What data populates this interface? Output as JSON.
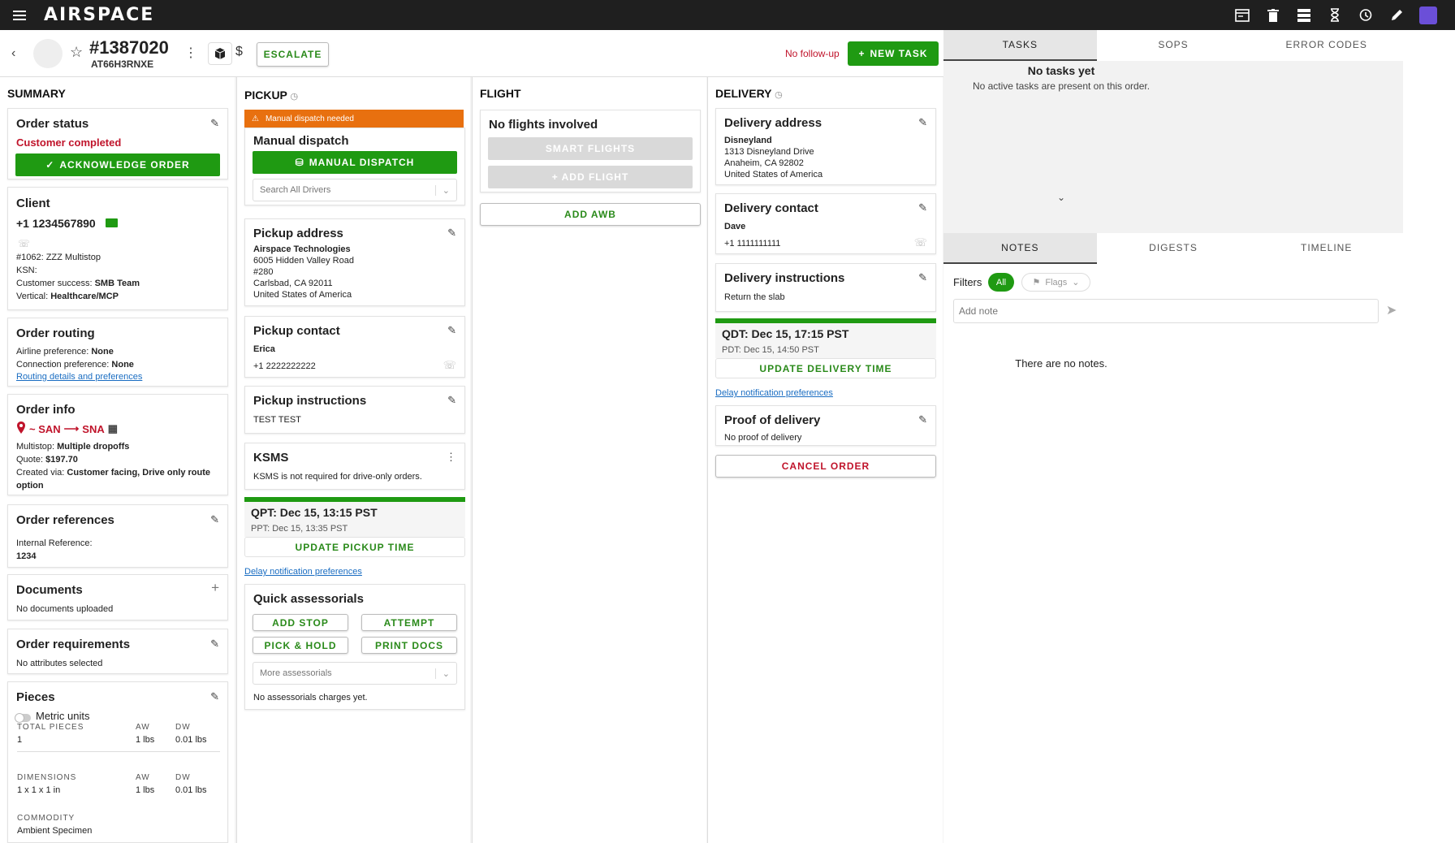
{
  "app": {
    "logo": "AIRSPACE"
  },
  "header": {
    "order_number": "#1387020",
    "order_code": "AT66H3RNXE",
    "escalate_label": "ESCALATE",
    "follow_up": "No follow-up",
    "new_task_label": "NEW TASK",
    "currency_symbol": "$"
  },
  "summary": {
    "title": "SUMMARY",
    "order_status": {
      "title": "Order status",
      "value": "Customer completed",
      "button": "ACKNOWLEDGE ORDER"
    },
    "client": {
      "title": "Client",
      "phone": "+1 1234567890",
      "account": "#1062: ZZZ Multistop",
      "ksn_label": "KSN:",
      "success_label": "Customer success:",
      "success_value": "SMB Team",
      "vertical_label": "Vertical:",
      "vertical_value": "Healthcare/MCP"
    },
    "routing": {
      "title": "Order routing",
      "airline_label": "Airline preference:",
      "airline_value": "None",
      "connection_label": "Connection preference:",
      "connection_value": "None",
      "link": "Routing details and preferences"
    },
    "info": {
      "title": "Order info",
      "origin": "~ SAN",
      "destination": "SNA",
      "multistop_label": "Multistop:",
      "multistop_value": "Multiple dropoffs",
      "quote_label": "Quote:",
      "quote_value": "$197.70",
      "created_label": "Created via:",
      "created_value": "Customer facing, Drive only route",
      "created_value_2": "option"
    },
    "references": {
      "title": "Order references",
      "label": "Internal Reference:",
      "value": "1234"
    },
    "documents": {
      "title": "Documents",
      "text": "No documents uploaded"
    },
    "requirements": {
      "title": "Order requirements",
      "text": "No attributes selected"
    },
    "pieces": {
      "title": "Pieces",
      "metric_label": "Metric units",
      "total_label": "TOTAL PIECES",
      "aw_label": "AW",
      "dw_label": "DW",
      "total_value": "1",
      "aw_value": "1 lbs",
      "dw_value": "0.01 lbs",
      "dims_label": "DIMENSIONS",
      "dims_value": "1 x 1 x 1 in",
      "aw2_value": "1 lbs",
      "dw2_value": "0.01 lbs",
      "commodity_label": "COMMODITY",
      "commodity_value": "Ambient Specimen"
    }
  },
  "pickup": {
    "title": "PICKUP",
    "alert": "Manual dispatch needed",
    "dispatch_title": "Manual dispatch",
    "dispatch_button": "MANUAL DISPATCH",
    "driver_placeholder": "Search All Drivers",
    "address": {
      "title": "Pickup address",
      "name": "Airspace Technologies",
      "line1": "6005 Hidden Valley Road",
      "line2": "#280",
      "line3": "Carlsbad, CA 92011",
      "line4": "United States of America"
    },
    "contact": {
      "title": "Pickup contact",
      "name": "Erica",
      "phone": "+1 2222222222"
    },
    "instructions": {
      "title": "Pickup instructions",
      "text": "TEST TEST"
    },
    "ksms": {
      "title": "KSMS",
      "text": "KSMS is not required for drive-only orders."
    },
    "qpt": "QPT: Dec 15, 13:15 PST",
    "ppt": "PPT: Dec 15, 13:35 PST",
    "update_button": "UPDATE PICKUP TIME",
    "delay_link": "Delay notification preferences",
    "assessorials": {
      "title": "Quick assessorials",
      "buttons": [
        "ADD STOP",
        "ATTEMPT",
        "PICK & HOLD",
        "PRINT DOCS"
      ],
      "more_placeholder": "More assessorials",
      "none_text": "No assessorials charges yet."
    }
  },
  "flight": {
    "title": "FLIGHT",
    "none_title": "No flights involved",
    "smart_button": "SMART FLIGHTS",
    "add_button": "+ ADD FLIGHT",
    "awb_button": "ADD AWB"
  },
  "delivery": {
    "title": "DELIVERY",
    "address": {
      "title": "Delivery address",
      "name": "Disneyland",
      "line1": "1313 Disneyland Drive",
      "line2": "Anaheim, CA 92802",
      "line3": "United States of America"
    },
    "contact": {
      "title": "Delivery contact",
      "name": "Dave",
      "phone": "+1 1111111111"
    },
    "instructions": {
      "title": "Delivery instructions",
      "text": "Return the slab"
    },
    "qdt": "QDT: Dec 15, 17:15 PST",
    "pdt": "PDT: Dec 15, 14:50 PST",
    "update_button": "UPDATE DELIVERY TIME",
    "delay_link": "Delay notification preferences",
    "proof": {
      "title": "Proof of delivery",
      "text": "No proof of delivery"
    },
    "cancel_button": "CANCEL ORDER"
  },
  "right_panel": {
    "top_tabs": [
      "TASKS",
      "SOPS",
      "ERROR CODES"
    ],
    "no_tasks_title": "No tasks yet",
    "no_tasks_text": "No active tasks are present on this order.",
    "bottom_tabs": [
      "NOTES",
      "DIGESTS",
      "TIMELINE"
    ],
    "filters_label": "Filters",
    "filter_all": "All",
    "flags_label": "Flags",
    "note_placeholder": "Add note",
    "no_notes": "There are no notes."
  },
  "colors": {
    "green": "#1f9a12",
    "red": "#c0142b",
    "orange": "#e8700f",
    "link": "#1a6dc2"
  },
  "icons": [
    "menu-icon",
    "star-icon",
    "kebab-icon",
    "package-icon",
    "pencil-icon",
    "email-icon",
    "phone-icon",
    "map-pin-icon",
    "map-icon",
    "plus-icon",
    "warning-icon",
    "car-icon",
    "chevron-down-icon",
    "send-icon",
    "flag-icon",
    "clock-icon",
    "trash-icon",
    "hourglass-icon",
    "history-icon"
  ]
}
